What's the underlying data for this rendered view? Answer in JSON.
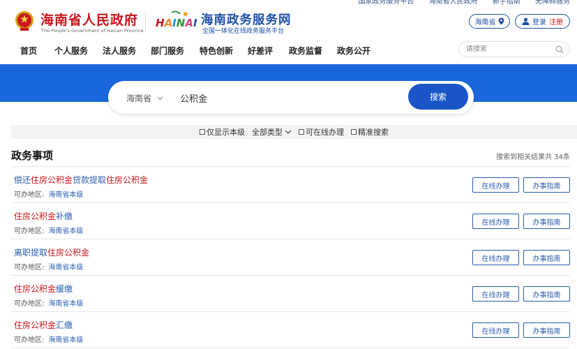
{
  "top_links": [
    "国家政务服务平台",
    "海南省人民政府",
    "新手指南",
    "无障碍服务"
  ],
  "header": {
    "gov_title": "海南省人民政府",
    "gov_subtitle": "The People's Government of Hainan Province",
    "service_logo_text": "HAINAN",
    "service_title": "海南政务服务网",
    "service_subtitle": "全国一体化在线政务服务平台",
    "region_button": "海南省",
    "login_label": "登录",
    "register_label": "注册"
  },
  "nav": {
    "items": [
      "首页",
      "个人服务",
      "法人服务",
      "部门服务",
      "特色创新",
      "好差评",
      "政务监督",
      "政务公开"
    ],
    "search_placeholder": "请搜索"
  },
  "search": {
    "region": "海南省",
    "query": "公积金",
    "button": "搜索"
  },
  "filters": {
    "only_this_level": "仅显示本级",
    "all_types": "全部类型",
    "online_available": "可在线办理",
    "exact_search": "精准搜索"
  },
  "section": {
    "title": "政务事项",
    "result_count": "搜索到相关结果共 34条"
  },
  "results": [
    {
      "segments": [
        {
          "t": "偿还",
          "hl": false
        },
        {
          "t": "住房公积金",
          "hl": true
        },
        {
          "t": "贷款提取",
          "hl": false
        },
        {
          "t": "住房公积金",
          "hl": true
        }
      ],
      "area_label": "可办地区:",
      "area": "海南省本级",
      "online_button": "在线办理",
      "guide_button": "办事指南"
    },
    {
      "segments": [
        {
          "t": "住房公积金",
          "hl": true
        },
        {
          "t": "补缴",
          "hl": false
        }
      ],
      "area_label": "可办地区:",
      "area": "海南省本级",
      "online_button": "在线办理",
      "guide_button": "办事指南"
    },
    {
      "segments": [
        {
          "t": "离职提取",
          "hl": false
        },
        {
          "t": "住房公积金",
          "hl": true
        }
      ],
      "area_label": "可办地区:",
      "area": "海南省本级",
      "online_button": "在线办理",
      "guide_button": "办事指南"
    },
    {
      "segments": [
        {
          "t": "住房公积金",
          "hl": true
        },
        {
          "t": "缓缴",
          "hl": false
        }
      ],
      "area_label": "可办地区:",
      "area": "海南省本级",
      "online_button": "在线办理",
      "guide_button": "办事指南"
    },
    {
      "segments": [
        {
          "t": "住房公积金",
          "hl": true
        },
        {
          "t": "汇缴",
          "hl": false
        }
      ],
      "area_label": "可办地区:",
      "area": "海南省本级",
      "online_button": "在线办理",
      "guide_button": "办事指南"
    }
  ],
  "icons": {
    "emblem": "national-emblem-icon",
    "region": "location-pin-icon",
    "user": "user-icon",
    "search": "search-icon",
    "dropdown": "chevron-down-icon"
  },
  "colors": {
    "brand_red": "#c8161d",
    "brand_blue": "#1d4fa8",
    "banner_blue": "#1a67dd",
    "button_blue": "#1a56c8"
  }
}
